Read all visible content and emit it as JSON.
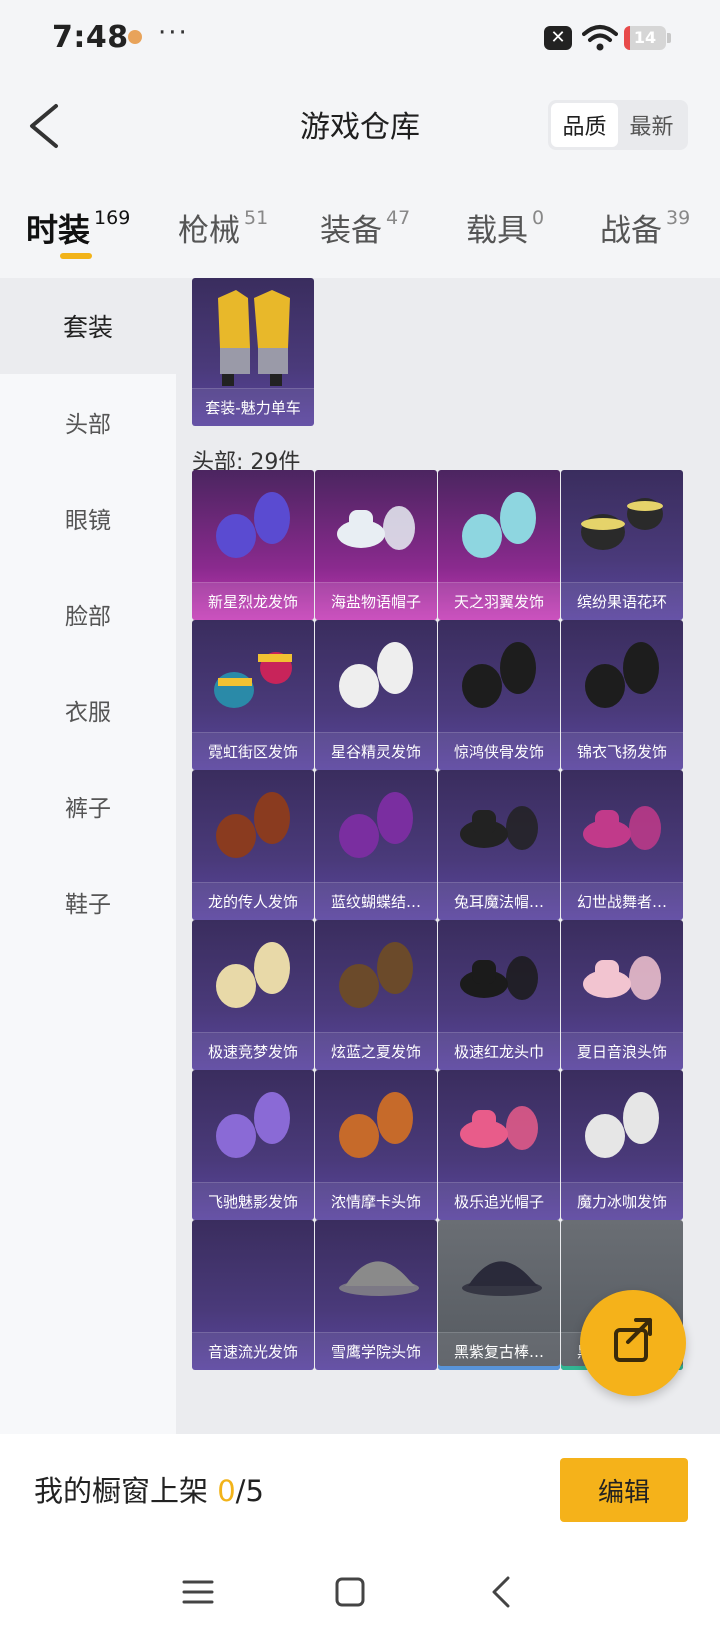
{
  "status_bar": {
    "time": "7:48",
    "more": "···",
    "battery": "14",
    "battery_level": 0.14
  },
  "header": {
    "title": "游戏仓库",
    "sort_options": [
      "品质",
      "最新"
    ],
    "active_sort": "品质"
  },
  "tabs": [
    {
      "label": "时装",
      "count": "169"
    },
    {
      "label": "枪械",
      "count": "51"
    },
    {
      "label": "装备",
      "count": "47"
    },
    {
      "label": "载具",
      "count": "0"
    },
    {
      "label": "战备",
      "count": "39"
    }
  ],
  "sidebar": [
    "套装",
    "头部",
    "眼镜",
    "脸部",
    "衣服",
    "裤子",
    "鞋子"
  ],
  "sets": [
    {
      "name": "套装-魅力单车"
    }
  ],
  "head_section": {
    "label": "头部: 29件"
  },
  "head_items": [
    {
      "name": "新星烈龙发饰",
      "style": "purple",
      "icon": "hair-icon",
      "color": "#5a4bd1"
    },
    {
      "name": "海盐物语帽子",
      "style": "purple",
      "icon": "hat-icon",
      "color": "#e8eef3"
    },
    {
      "name": "天之羽翼发饰",
      "style": "purple",
      "icon": "hair-icon",
      "color": "#8ed6e0"
    },
    {
      "name": "缤纷果语花环",
      "style": "normal",
      "icon": "wreath-icon",
      "color": "#e5d36a"
    },
    {
      "name": "霓虹街区发饰",
      "style": "normal",
      "icon": "glasses-icon",
      "color": "#f1c232"
    },
    {
      "name": "星谷精灵发饰",
      "style": "normal",
      "icon": "hair-icon",
      "color": "#eeeeee"
    },
    {
      "name": "惊鸿侠骨发饰",
      "style": "normal",
      "icon": "hair-icon",
      "color": "#1d1d1d"
    },
    {
      "name": "锦衣飞扬发饰",
      "style": "normal",
      "icon": "hair-icon",
      "color": "#1d1d1d"
    },
    {
      "name": "龙的传人发饰",
      "style": "normal",
      "icon": "hair-icon",
      "color": "#8a3b1f"
    },
    {
      "name": "蓝纹蝴蝶结…",
      "style": "normal",
      "icon": "hair-icon",
      "color": "#7a2ea0"
    },
    {
      "name": "兔耳魔法帽…",
      "style": "normal",
      "icon": "hat-icon",
      "color": "#222222"
    },
    {
      "name": "幻世战舞者…",
      "style": "normal",
      "icon": "hat-icon",
      "color": "#c13a8a"
    },
    {
      "name": "极速竞梦发饰",
      "style": "normal",
      "icon": "hair-icon",
      "color": "#e8d9a8"
    },
    {
      "name": "炫蓝之夏发饰",
      "style": "normal",
      "icon": "hair-icon",
      "color": "#6b4a2a"
    },
    {
      "name": "极速红龙头巾",
      "style": "normal",
      "icon": "hat-icon",
      "color": "#1b1b1b"
    },
    {
      "name": "夏日音浪头饰",
      "style": "normal",
      "icon": "hat-icon",
      "color": "#f2c4d0"
    },
    {
      "name": "飞驰魅影发饰",
      "style": "normal",
      "icon": "hair-icon",
      "color": "#8a6ad6"
    },
    {
      "name": "浓情摩卡头饰",
      "style": "normal",
      "icon": "hair-icon",
      "color": "#c66a2a"
    },
    {
      "name": "极乐追光帽子",
      "style": "normal",
      "icon": "hat-icon",
      "color": "#e85c8a"
    },
    {
      "name": "魔力冰咖发饰",
      "style": "normal",
      "icon": "hair-icon",
      "color": "#e6e6e6"
    },
    {
      "name": "音速流光发饰",
      "style": "normal",
      "icon": "none",
      "color": "#4a3a7a"
    },
    {
      "name": "雪鹰学院头饰",
      "style": "normal",
      "icon": "cap-icon",
      "color": "#8a8a8a"
    },
    {
      "name": "黑紫复古棒…",
      "style": "gray-blue",
      "icon": "cap-icon",
      "color": "#2a2a3a"
    },
    {
      "name": "黑白游荡者…",
      "style": "gray-green",
      "icon": "none",
      "color": "#555555"
    }
  ],
  "bottom": {
    "showcase_prefix": "我的橱窗上架 ",
    "showcase_used": "0",
    "showcase_total": "/5",
    "edit_label": "编辑"
  }
}
